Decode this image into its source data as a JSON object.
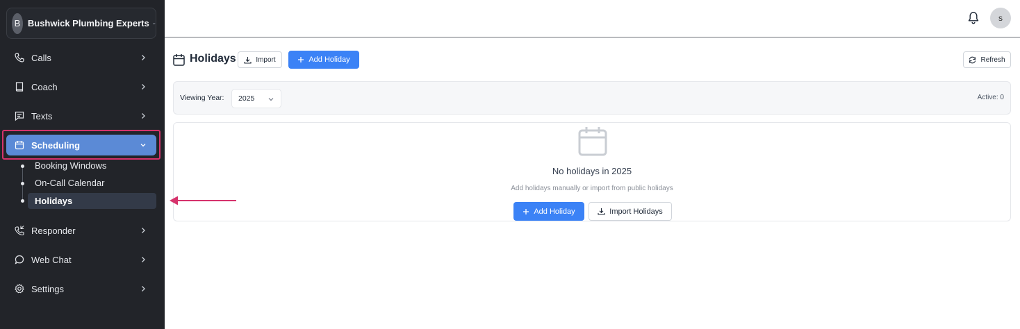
{
  "org": {
    "initial": "B",
    "name": "Bushwick Plumbing Experts"
  },
  "nav": {
    "calls": "Calls",
    "coach": "Coach",
    "texts": "Texts",
    "scheduling": "Scheduling",
    "scheduling_sub": [
      "Booking Windows",
      "On-Call Calendar",
      "Holidays"
    ],
    "responder": "Responder",
    "web_chat": "Web Chat",
    "settings": "Settings"
  },
  "topbar": {
    "user_initial": "s"
  },
  "page": {
    "title": "Holidays",
    "import_label": "Import",
    "add_holiday_label": "Add Holiday",
    "refresh_label": "Refresh"
  },
  "filter": {
    "viewing_year_label": "Viewing Year:",
    "year_value": "2025",
    "active_count": "Active: 0"
  },
  "empty_state": {
    "title": "No holidays in 2025",
    "subtitle": "Add holidays manually or import from public holidays",
    "add_label": "Add Holiday",
    "import_label": "Import Holidays"
  },
  "colors": {
    "sidebar_bg": "#222429",
    "active_nav": "#5b8ad6",
    "primary": "#3b82f6",
    "annotation": "#d6336c"
  },
  "icons": [
    "phone-icon",
    "book-icon",
    "message-icon",
    "calendar-icon",
    "phone-forward-icon",
    "chat-bubble-icon",
    "gear-icon",
    "bell-icon",
    "download-icon",
    "plus-icon",
    "refresh-icon",
    "chevron-right-icon",
    "chevron-down-icon"
  ]
}
